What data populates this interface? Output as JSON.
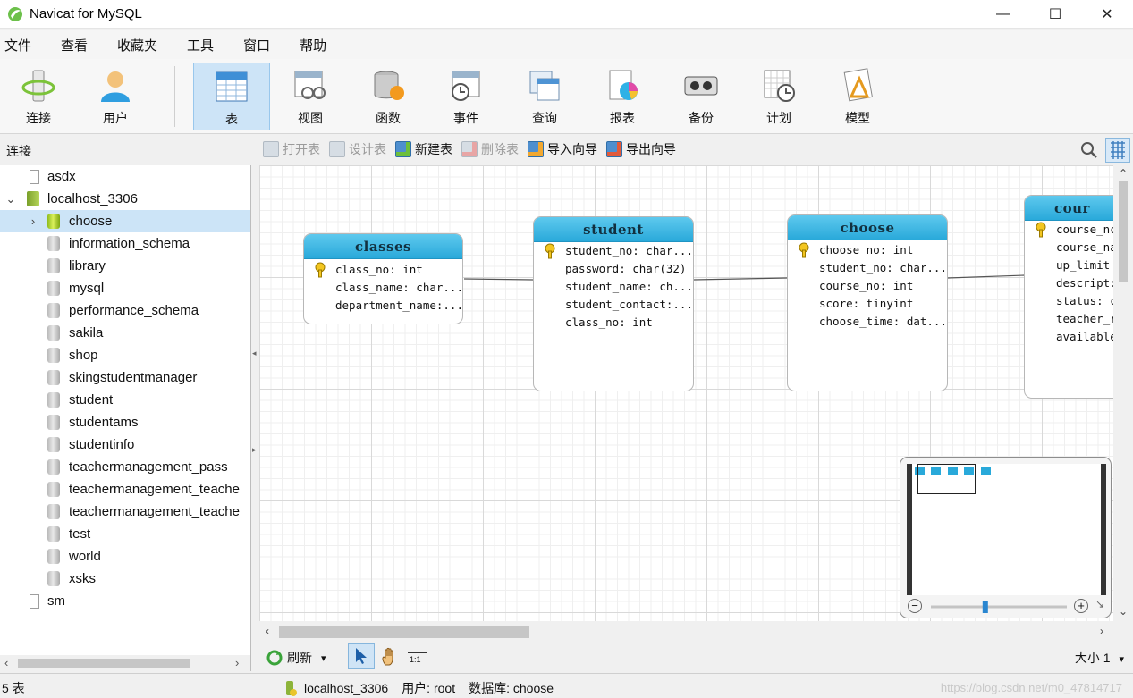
{
  "window": {
    "title": "Navicat for MySQL",
    "minimize": "—",
    "maximize": "☐",
    "close": "✕"
  },
  "menu": [
    "文件",
    "查看",
    "收藏夹",
    "工具",
    "窗口",
    "帮助"
  ],
  "toolbar": {
    "items": [
      {
        "label": "连接",
        "icon": "connection-icon"
      },
      {
        "label": "用户",
        "icon": "user-icon"
      },
      {
        "label": "表",
        "icon": "table-icon",
        "active": true
      },
      {
        "label": "视图",
        "icon": "view-icon"
      },
      {
        "label": "函数",
        "icon": "function-icon"
      },
      {
        "label": "事件",
        "icon": "event-icon"
      },
      {
        "label": "查询",
        "icon": "query-icon"
      },
      {
        "label": "报表",
        "icon": "report-icon"
      },
      {
        "label": "备份",
        "icon": "backup-icon"
      },
      {
        "label": "计划",
        "icon": "schedule-icon"
      },
      {
        "label": "模型",
        "icon": "model-icon"
      }
    ]
  },
  "subbar": {
    "connection_label": "连接",
    "actions": [
      {
        "label": "打开表",
        "enabled": false
      },
      {
        "label": "设计表",
        "enabled": false
      },
      {
        "label": "新建表",
        "enabled": true
      },
      {
        "label": "删除表",
        "enabled": false
      },
      {
        "label": "导入向导",
        "enabled": true
      },
      {
        "label": "导出向导",
        "enabled": true
      }
    ]
  },
  "sidebar": {
    "items": [
      {
        "label": "asdx",
        "level": 0,
        "type": "connection"
      },
      {
        "label": "localhost_3306",
        "level": 0,
        "type": "host",
        "expanded": true
      },
      {
        "label": "choose",
        "level": 1,
        "type": "database",
        "selected": true
      },
      {
        "label": "information_schema",
        "level": 1,
        "type": "database"
      },
      {
        "label": "library",
        "level": 1,
        "type": "database"
      },
      {
        "label": "mysql",
        "level": 1,
        "type": "database"
      },
      {
        "label": "performance_schema",
        "level": 1,
        "type": "database"
      },
      {
        "label": "sakila",
        "level": 1,
        "type": "database"
      },
      {
        "label": "shop",
        "level": 1,
        "type": "database"
      },
      {
        "label": "skingstudentmanager",
        "level": 1,
        "type": "database"
      },
      {
        "label": "student",
        "level": 1,
        "type": "database"
      },
      {
        "label": "studentams",
        "level": 1,
        "type": "database"
      },
      {
        "label": "studentinfo",
        "level": 1,
        "type": "database"
      },
      {
        "label": "teachermanagement_pass",
        "level": 1,
        "type": "database"
      },
      {
        "label": "teachermanagement_teache",
        "level": 1,
        "type": "database"
      },
      {
        "label": "teachermanagement_teache",
        "level": 1,
        "type": "database"
      },
      {
        "label": "test",
        "level": 1,
        "type": "database"
      },
      {
        "label": "world",
        "level": 1,
        "type": "database"
      },
      {
        "label": "xsks",
        "level": 1,
        "type": "database"
      },
      {
        "label": "sm",
        "level": 0,
        "type": "connection"
      }
    ]
  },
  "erd": {
    "tables": [
      {
        "name": "classes",
        "fields": [
          "class_no: int",
          "class_name: char...",
          "department_name:..."
        ],
        "key_rows": [
          0
        ]
      },
      {
        "name": "student",
        "fields": [
          "student_no: char...",
          "password: char(32)",
          "student_name: ch...",
          "student_contact:...",
          "class_no: int"
        ],
        "key_rows": [
          0
        ]
      },
      {
        "name": "choose",
        "fields": [
          "choose_no: int",
          "student_no: char...",
          "course_no: int",
          "score: tinyint",
          "choose_time: dat..."
        ],
        "key_rows": [
          0
        ]
      },
      {
        "name": "cour",
        "fields": [
          "course_nc",
          "course_na",
          "up_limit",
          "descript:",
          "status: c",
          "teacher_r",
          "available"
        ],
        "key_rows": [
          0
        ]
      }
    ]
  },
  "navigator": {
    "zoom_out": "−",
    "zoom_in": "+",
    "zoom_level": 0.4
  },
  "bottombar": {
    "refresh_label": "刷新",
    "dropdown_arrow": "▾",
    "ratio_label": "1:1",
    "size_label": "大小 1",
    "size_arrow": "▾"
  },
  "status": {
    "count": "5 表",
    "host": "localhost_3306",
    "user": "用户: root",
    "database": "数据库: choose",
    "watermark": "https://blog.csdn.net/m0_47814717"
  }
}
